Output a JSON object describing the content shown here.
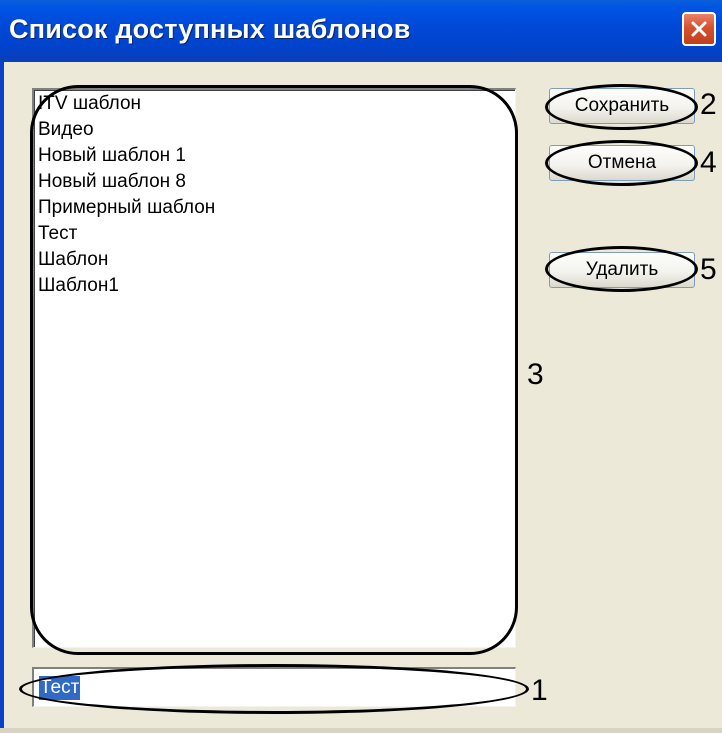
{
  "window": {
    "title": "Список доступных шаблонов"
  },
  "templates": {
    "items": [
      "ITV шаблон",
      "Видео",
      "Новый шаблон 1",
      "Новый шаблон 8",
      "Примерный шаблон",
      "Тест",
      "Шаблон",
      "Шаблон1"
    ]
  },
  "buttons": {
    "save_label": "Сохранить",
    "cancel_label": "Отмена",
    "delete_label": "Удалить"
  },
  "name_field": {
    "value": "Тест"
  },
  "callouts": {
    "field": "1",
    "save": "2",
    "list": "3",
    "cancel": "4",
    "delete": "5"
  },
  "colors": {
    "titlebar": "#0049d8",
    "close_button": "#d6512e",
    "dialog_face": "#ece9d8",
    "selection": "#316ac5"
  }
}
